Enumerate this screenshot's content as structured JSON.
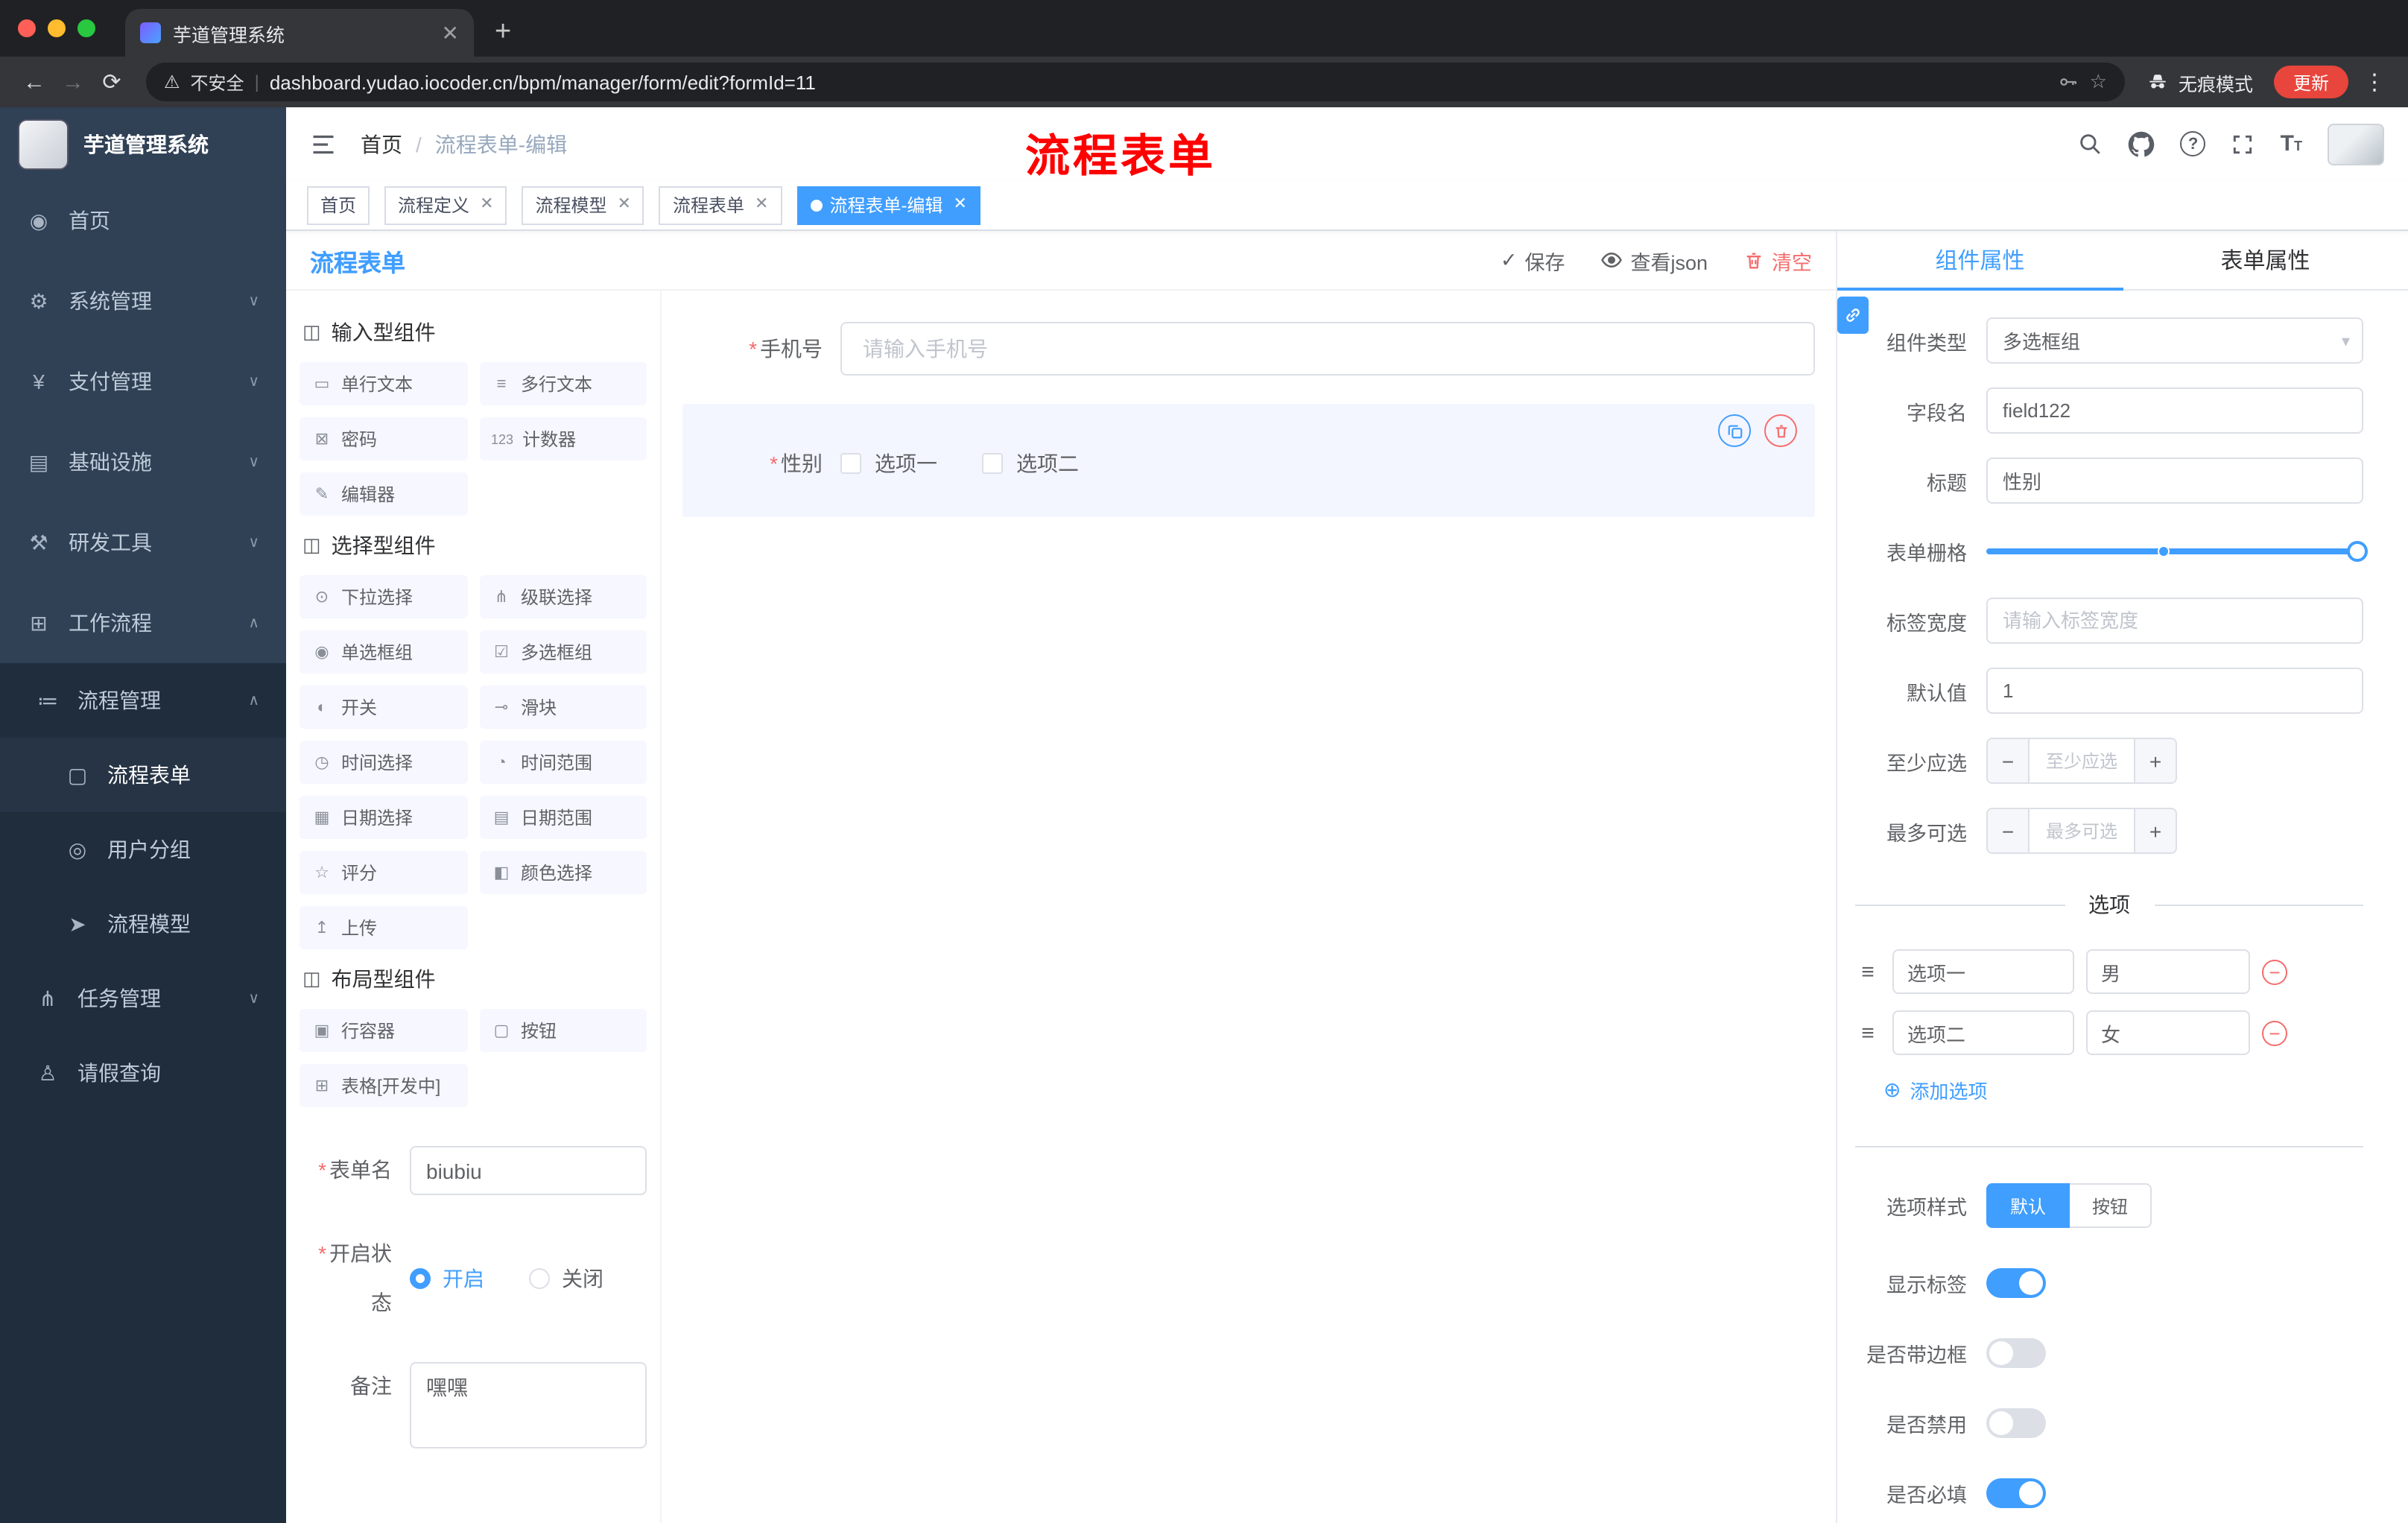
{
  "browser": {
    "tab_title": "芋道管理系统",
    "security_label": "不安全",
    "url": "dashboard.yudao.iocoder.cn/bpm/manager/form/edit?formId=11",
    "incognito_label": "无痕模式",
    "update_label": "更新"
  },
  "sidebar": {
    "brand": "芋道管理系统",
    "menu": [
      {
        "label": "首页",
        "glyph": "◉"
      },
      {
        "label": "系统管理",
        "glyph": "⚙",
        "arrow": "∨"
      },
      {
        "label": "支付管理",
        "glyph": "¥",
        "arrow": "∨"
      },
      {
        "label": "基础设施",
        "glyph": "▤",
        "arrow": "∨"
      },
      {
        "label": "研发工具",
        "glyph": "⚒",
        "arrow": "∨"
      },
      {
        "label": "工作流程",
        "glyph": "⊞",
        "arrow": "∧"
      }
    ],
    "submenu": {
      "group_label": "流程管理",
      "group_glyph": "≔",
      "group_arrow": "∧",
      "children": [
        {
          "label": "流程表单",
          "glyph": "▢"
        },
        {
          "label": "用户分组",
          "glyph": "◎"
        },
        {
          "label": "流程模型",
          "glyph": "➤"
        }
      ],
      "task_label": "任务管理",
      "task_glyph": "⋔",
      "task_arrow": "∨",
      "leave_label": "请假查询",
      "leave_glyph": "♙"
    }
  },
  "header": {
    "breadcrumb_home": "首页",
    "breadcrumb_sep": "/",
    "breadcrumb_current": "流程表单-编辑",
    "annotation": "流程表单"
  },
  "tags": [
    {
      "label": "首页"
    },
    {
      "label": "流程定义"
    },
    {
      "label": "流程模型"
    },
    {
      "label": "流程表单"
    },
    {
      "label": "流程表单-编辑"
    }
  ],
  "designer": {
    "title": "流程表单",
    "save": "保存",
    "view_json": "查看json",
    "clear": "清空",
    "group_titles": [
      "输入型组件",
      "选择型组件",
      "布局型组件"
    ],
    "input_components": [
      {
        "label": "单行文本",
        "glyph": "▭"
      },
      {
        "label": "多行文本",
        "glyph": "≡"
      },
      {
        "label": "密码",
        "glyph": "⊠"
      },
      {
        "label": "计数器",
        "glyph": "123"
      },
      {
        "label": "编辑器",
        "glyph": "✎"
      }
    ],
    "select_components": [
      {
        "label": "下拉选择",
        "glyph": "⊙"
      },
      {
        "label": "级联选择",
        "glyph": "⋔"
      },
      {
        "label": "单选框组",
        "glyph": "◉"
      },
      {
        "label": "多选框组",
        "glyph": "☑"
      },
      {
        "label": "开关",
        "glyph": "◐"
      },
      {
        "label": "滑块",
        "glyph": "⊸"
      },
      {
        "label": "时间选择",
        "glyph": "◷"
      },
      {
        "label": "时间范围",
        "glyph": "◔"
      },
      {
        "label": "日期选择",
        "glyph": "▦"
      },
      {
        "label": "日期范围",
        "glyph": "▤"
      },
      {
        "label": "评分",
        "glyph": "☆"
      },
      {
        "label": "颜色选择",
        "glyph": "◧"
      },
      {
        "label": "上传",
        "glyph": "↥"
      }
    ],
    "layout_components": [
      {
        "label": "行容器",
        "glyph": "▣"
      },
      {
        "label": "按钮",
        "glyph": "▢"
      },
      {
        "label": "表格[开发中]",
        "glyph": "⊞"
      }
    ],
    "meta": {
      "name_label": "表单名",
      "name_value": "biubiu",
      "status_label": "开启状态",
      "status_on": "开启",
      "status_off": "关闭",
      "remark_label": "备注",
      "remark_value": "嘿嘿"
    },
    "canvas": {
      "phone_label": "手机号",
      "phone_placeholder": "请输入手机号",
      "gender_label": "性别",
      "gender_option1": "选项一",
      "gender_option2": "选项二"
    }
  },
  "props": {
    "tab_component": "组件属性",
    "tab_form": "表单属性",
    "component_type_label": "组件类型",
    "component_type_value": "多选框组",
    "field_name_label": "字段名",
    "field_name_value": "field122",
    "title_label": "标题",
    "title_value": "性别",
    "grid_label": "表单栅格",
    "label_width_label": "标签宽度",
    "label_width_placeholder": "请输入标签宽度",
    "default_label": "默认值",
    "default_value": "1",
    "min_label": "至少应选",
    "min_placeholder": "至少应选",
    "max_label": "最多可选",
    "max_placeholder": "最多可选",
    "options_title": "选项",
    "options": [
      {
        "label": "选项一",
        "value": "男"
      },
      {
        "label": "选项二",
        "value": "女"
      }
    ],
    "add_option": "添加选项",
    "style_label": "选项样式",
    "style_default": "默认",
    "style_button": "按钮",
    "toggle_show_label": "显示标签",
    "toggle_border": "是否带边框",
    "toggle_disabled": "是否禁用",
    "toggle_required": "是否必填"
  },
  "colors": {
    "accent": "#409eff",
    "danger": "#f56c6c",
    "annotation": "#fe0000",
    "sidebar_bg": "#304156",
    "submenu_bg": "#1f2d3d"
  }
}
